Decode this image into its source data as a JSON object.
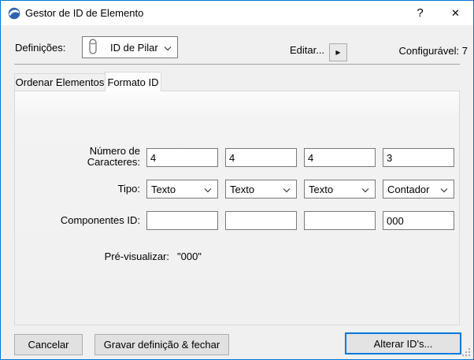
{
  "window": {
    "title": "Gestor de ID de Elemento",
    "help_glyph": "?",
    "close_glyph": "✕"
  },
  "header": {
    "settings_label": "Definições:",
    "preset_value": "ID de Pilar",
    "edit_label": "Editar...",
    "edit_button_glyph": "▶",
    "configurable_label": "Configurável: 7"
  },
  "tabs": {
    "sort_elements_label": "Ordenar Elementos",
    "id_format_label": "Formato ID"
  },
  "form": {
    "num_chars_label": "Número de Caracteres:",
    "num_chars": [
      "4",
      "4",
      "4",
      "3"
    ],
    "type_label": "Tipo:",
    "types": [
      "Texto",
      "Texto",
      "Texto",
      "Contador"
    ],
    "components_label": "Componentes ID:",
    "components": [
      "",
      "",
      "",
      "000"
    ],
    "preview_label": "Pré-visualizar:",
    "preview_value": "\"000\""
  },
  "footer": {
    "cancel_label": "Cancelar",
    "save_label": "Gravar definição & fechar",
    "change_ids_label": "Alterar ID's..."
  },
  "colors": {
    "accent": "#0078d7",
    "dialog_bg": "#f0f0f0",
    "titlebar_bg": "#ffffff"
  }
}
